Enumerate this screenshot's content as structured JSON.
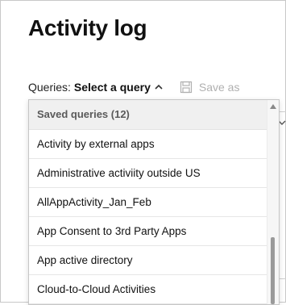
{
  "page": {
    "title": "Activity log"
  },
  "queries_bar": {
    "label": "Queries:",
    "select_label": "Select a query",
    "save_as_label": "Save as"
  },
  "dropdown": {
    "header": "Saved queries (12)",
    "items": [
      "Activity by external apps",
      "Administrative activiity outside US",
      "AllAppActivity_Jan_Feb",
      "App Consent to 3rd Party Apps",
      "App active directory",
      "Cloud-to-Cloud Activities"
    ]
  },
  "icons": {
    "chevron": "chevron-up-icon",
    "save": "save-icon",
    "scroll_up": "scroll-up-arrow-icon"
  },
  "colors": {
    "header_bg": "#f0f0f0",
    "disabled_text": "#b0b0b0",
    "scroll_thumb": "#9a9a9a"
  }
}
